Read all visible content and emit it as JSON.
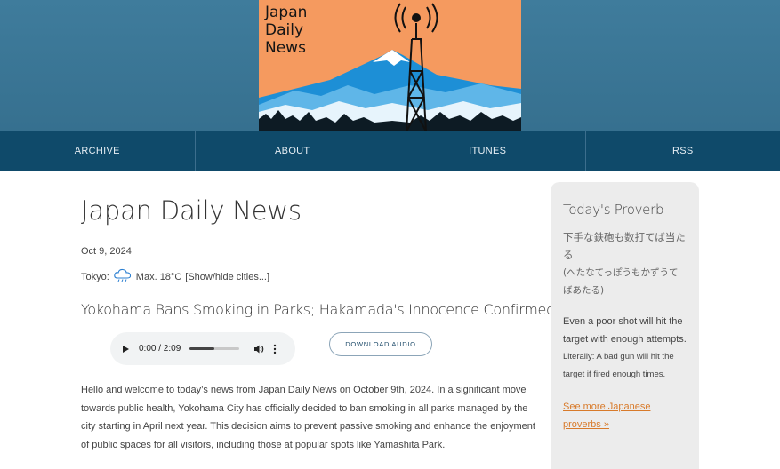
{
  "logo": {
    "lines": [
      "Japan",
      "Daily",
      "News"
    ]
  },
  "nav": {
    "items": [
      {
        "label": "ARCHIVE"
      },
      {
        "label": "ABOUT"
      },
      {
        "label": "ITUNES"
      },
      {
        "label": "RSS"
      }
    ]
  },
  "main": {
    "title": "Japan Daily News",
    "date": "Oct 9, 2024",
    "weather": {
      "city_label": "Tokyo:",
      "forecast": "Max. 18°C",
      "toggle": "[Show/hide cities...]",
      "icon": "rain-cloud-icon"
    },
    "headline": "Yokohama Bans Smoking in Parks; Hakamada's Innocence Confirmed, & more...",
    "player": {
      "time": "0:00 / 2:09",
      "buffered_fraction": 0.5
    },
    "download_label": "DOWNLOAD AUDIO",
    "body": "Hello and welcome to today’s news from Japan Daily News on October 9th, 2024. In a significant move towards public health, Yokohama City has officially decided to ban smoking in all parks managed by the city starting in April next year. This decision aims to prevent passive smoking and enhance the enjoyment of public spaces for all visitors, including those at popular spots like Yamashita Park."
  },
  "sidebar": {
    "title": "Today's Proverb",
    "proverb_jp": "下手な鉄砲も数打てば当たる",
    "proverb_kana": "(へたなてっぽうもかずうてばあたる)",
    "proverb_en": "Even a poor shot will hit the target with enough attempts.",
    "proverb_literal": "Literally: A bad gun will hit the target if fired enough times.",
    "link": "See more Japanese proverbs »"
  },
  "colors": {
    "header": "#3f7c9c",
    "nav": "#0f4a6a",
    "logo_bg": "#f59a5f",
    "link": "#d87a2a"
  }
}
